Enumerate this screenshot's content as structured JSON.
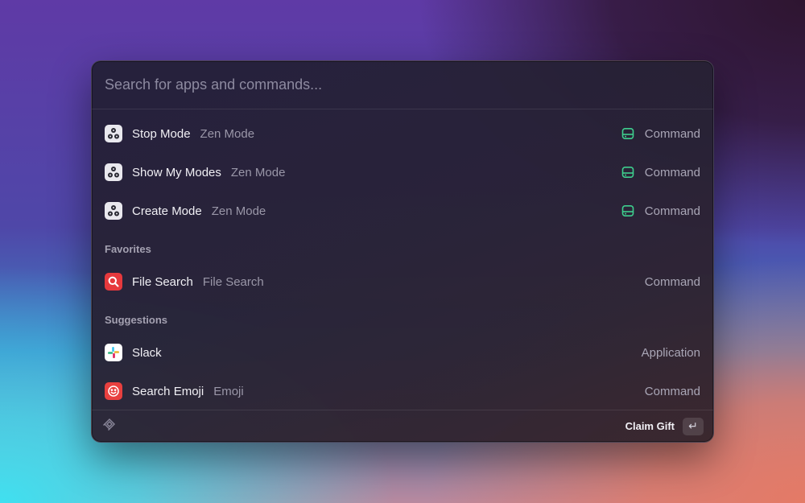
{
  "search": {
    "placeholder": "Search for apps and commands..."
  },
  "results": [
    {
      "title": "Stop Mode",
      "subtitle": "Zen Mode",
      "type": "Command",
      "icon": "zen-mode-icon"
    },
    {
      "title": "Show My Modes",
      "subtitle": "Zen Mode",
      "type": "Command",
      "icon": "zen-mode-icon"
    },
    {
      "title": "Create Mode",
      "subtitle": "Zen Mode",
      "type": "Command",
      "icon": "zen-mode-icon"
    }
  ],
  "favorites": {
    "title": "Favorites",
    "items": [
      {
        "title": "File Search",
        "subtitle": "File Search",
        "type": "Command",
        "icon": "file-search-icon"
      }
    ]
  },
  "suggestions": {
    "title": "Suggestions",
    "items": [
      {
        "title": "Slack",
        "subtitle": "",
        "type": "Application",
        "icon": "slack-icon"
      },
      {
        "title": "Search Emoji",
        "subtitle": "Emoji",
        "type": "Command",
        "icon": "emoji-icon"
      }
    ]
  },
  "footer": {
    "action_label": "Claim Gift",
    "shortcut": "↵",
    "icon": "raycast-logo-icon"
  },
  "colors": {
    "accent_green": "#3ecf8e",
    "file_red": "#e6393d"
  }
}
